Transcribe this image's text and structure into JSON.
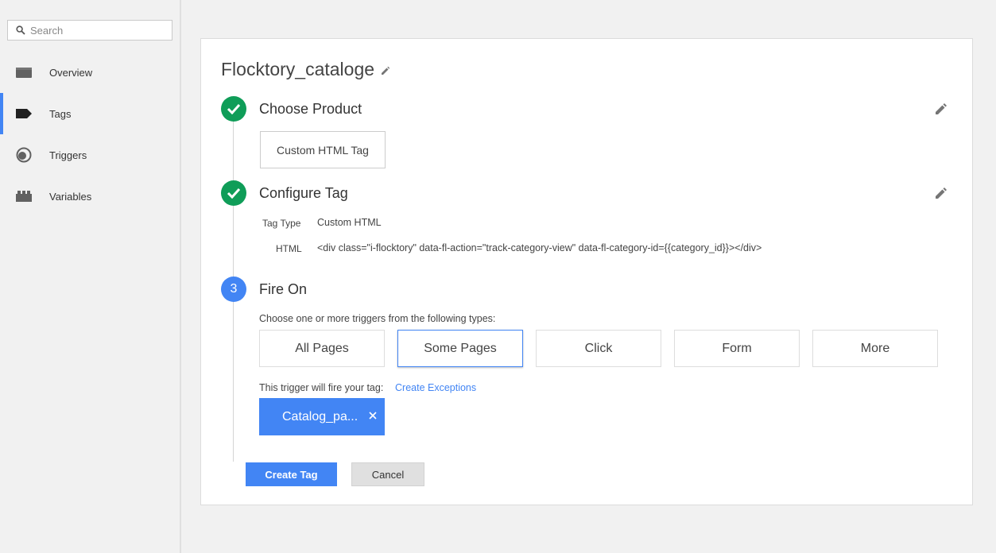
{
  "sidebar": {
    "search_placeholder": "Search",
    "items": [
      {
        "label": "Overview",
        "icon": "briefcase-icon",
        "active": false
      },
      {
        "label": "Tags",
        "icon": "tag-icon",
        "active": true
      },
      {
        "label": "Triggers",
        "icon": "trigger-icon",
        "active": false
      },
      {
        "label": "Variables",
        "icon": "blocks-icon",
        "active": false
      }
    ]
  },
  "tag": {
    "name": "Flocktory_cataloge"
  },
  "steps": {
    "product": {
      "title": "Choose Product",
      "selected": "Custom HTML Tag"
    },
    "configure": {
      "title": "Configure Tag",
      "tag_type_label": "Tag Type",
      "tag_type_value": "Custom HTML",
      "html_label": "HTML",
      "html_value": "<div class=\"i-flocktory\" data-fl-action=\"track-category-view\" data-fl-category-id={{category_id}}></div>"
    },
    "fire_on": {
      "number": "3",
      "title": "Fire On",
      "instruction": "Choose one or more triggers from the following types:",
      "types": [
        "All Pages",
        "Some Pages",
        "Click",
        "Form",
        "More"
      ],
      "selected_type": "Some Pages",
      "fire_text": "This trigger will fire your tag:",
      "create_exceptions": "Create Exceptions",
      "trigger_chip": "Catalog_pa..."
    }
  },
  "buttons": {
    "create": "Create Tag",
    "cancel": "Cancel"
  },
  "colors": {
    "accent": "#4285f4",
    "success": "#0f9d58"
  }
}
